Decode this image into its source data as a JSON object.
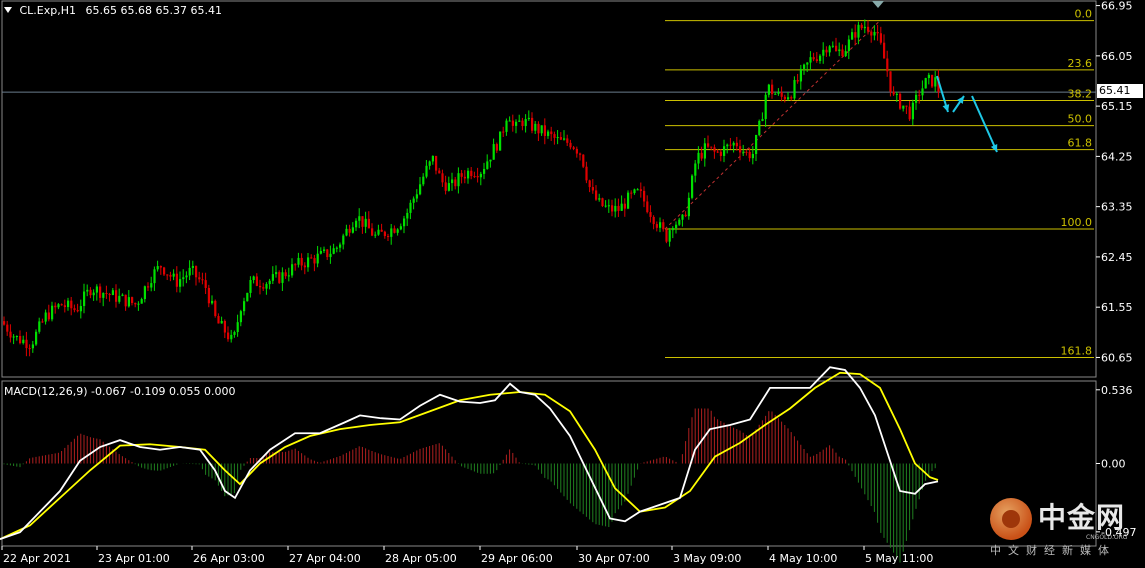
{
  "header": {
    "symbol_label": "CL.Exp,H1",
    "ohlc": "65.65 65.68 65.37 65.41"
  },
  "macd_header": {
    "label": "MACD(12,26,9)",
    "values": "-0.067 -0.109 0.055 0.000"
  },
  "current_price": "65.41",
  "watermark": {
    "brand": "中金网",
    "tagline": "中文财经新媒体",
    "domain": "CNGOLD.ORG"
  },
  "colors": {
    "bull": "#00e000",
    "bear": "#e00000",
    "fib": "#ccc000",
    "macd_line": "#ffffff",
    "signal_line": "#ffff00",
    "arrow": "#1ec8e6",
    "axis": "#ffffff"
  },
  "chart_data": [
    {
      "type": "candlestick",
      "symbol": "CL.Exp",
      "timeframe": "H1",
      "y_ticks": [
        "66.95",
        "66.05",
        "65.15",
        "64.25",
        "63.35",
        "62.45",
        "61.55",
        "60.65"
      ],
      "y_range": [
        60.3,
        67.05
      ],
      "x_ticks": [
        "22 Apr 2021",
        "23 Apr 01:00",
        "26 Apr 03:00",
        "27 Apr 04:00",
        "28 Apr 05:00",
        "29 Apr 06:00",
        "30 Apr 07:00",
        "3 May 09:00",
        "4 May 10:00",
        "5 May 11:00"
      ],
      "price_path": [
        [
          0,
          61.3
        ],
        [
          15,
          61.0
        ],
        [
          30,
          60.9
        ],
        [
          45,
          61.4
        ],
        [
          60,
          61.6
        ],
        [
          75,
          61.5
        ],
        [
          90,
          61.9
        ],
        [
          105,
          61.8
        ],
        [
          120,
          61.7
        ],
        [
          135,
          61.6
        ],
        [
          150,
          62.1
        ],
        [
          160,
          62.3
        ],
        [
          175,
          62.0
        ],
        [
          190,
          62.2
        ],
        [
          205,
          61.9
        ],
        [
          215,
          61.3
        ],
        [
          225,
          61.1
        ],
        [
          232,
          60.9
        ],
        [
          240,
          61.6
        ],
        [
          250,
          62.0
        ],
        [
          265,
          62.0
        ],
        [
          280,
          62.1
        ],
        [
          295,
          62.3
        ],
        [
          310,
          62.4
        ],
        [
          325,
          62.5
        ],
        [
          335,
          62.6
        ],
        [
          345,
          62.9
        ],
        [
          355,
          63.2
        ],
        [
          365,
          63.0
        ],
        [
          375,
          62.8
        ],
        [
          385,
          62.9
        ],
        [
          395,
          63.0
        ],
        [
          405,
          63.2
        ],
        [
          415,
          63.6
        ],
        [
          425,
          64.0
        ],
        [
          432,
          64.2
        ],
        [
          440,
          63.8
        ],
        [
          450,
          63.7
        ],
        [
          460,
          63.9
        ],
        [
          470,
          64.0
        ],
        [
          480,
          64.0
        ],
        [
          490,
          64.3
        ],
        [
          500,
          64.6
        ],
        [
          507,
          65.1
        ],
        [
          513,
          64.7
        ],
        [
          520,
          64.9
        ],
        [
          530,
          64.8
        ],
        [
          540,
          64.7
        ],
        [
          550,
          64.6
        ],
        [
          560,
          64.5
        ],
        [
          570,
          64.5
        ],
        [
          580,
          64.3
        ],
        [
          590,
          63.6
        ],
        [
          598,
          63.4
        ],
        [
          608,
          63.3
        ],
        [
          618,
          63.3
        ],
        [
          628,
          63.5
        ],
        [
          638,
          63.6
        ],
        [
          648,
          63.3
        ],
        [
          658,
          63.0
        ],
        [
          665,
          62.8
        ],
        [
          672,
          63.1
        ],
        [
          680,
          63.0
        ],
        [
          688,
          63.5
        ],
        [
          695,
          64.2
        ],
        [
          705,
          64.4
        ],
        [
          715,
          64.3
        ],
        [
          725,
          64.4
        ],
        [
          735,
          64.5
        ],
        [
          745,
          64.3
        ],
        [
          752,
          64.3
        ],
        [
          760,
          64.9
        ],
        [
          766,
          65.5
        ],
        [
          772,
          65.4
        ],
        [
          780,
          65.3
        ],
        [
          790,
          65.4
        ],
        [
          800,
          65.7
        ],
        [
          810,
          66.0
        ],
        [
          820,
          66.1
        ],
        [
          828,
          66.3
        ],
        [
          835,
          66.1
        ],
        [
          845,
          66.2
        ],
        [
          855,
          66.5
        ],
        [
          865,
          66.6
        ],
        [
          873,
          66.5
        ],
        [
          880,
          66.2
        ],
        [
          886,
          65.8
        ],
        [
          892,
          65.3
        ],
        [
          900,
          65.2
        ],
        [
          910,
          65.0
        ],
        [
          918,
          65.4
        ],
        [
          926,
          65.6
        ],
        [
          935,
          65.6
        ],
        [
          938,
          65.41
        ]
      ],
      "fibonacci": [
        {
          "label": "0.0",
          "price": 66.68
        },
        {
          "label": "23.6",
          "price": 65.8
        },
        {
          "label": "38.2",
          "price": 65.25
        },
        {
          "label": "50.0",
          "price": 64.8
        },
        {
          "label": "61.8",
          "price": 64.37
        },
        {
          "label": "100.0",
          "price": 62.95
        },
        {
          "label": "161.8",
          "price": 60.65
        }
      ]
    },
    {
      "type": "macd",
      "params": "12,26,9",
      "y_ticks": [
        "0.536",
        "0.00",
        "-0.497"
      ],
      "y_range": [
        -0.6,
        0.6
      ],
      "macd_path": [
        [
          0,
          -0.55
        ],
        [
          20,
          -0.5
        ],
        [
          40,
          -0.35
        ],
        [
          60,
          -0.2
        ],
        [
          80,
          0.02
        ],
        [
          100,
          0.12
        ],
        [
          120,
          0.17
        ],
        [
          140,
          0.12
        ],
        [
          160,
          0.1
        ],
        [
          180,
          0.12
        ],
        [
          200,
          0.1
        ],
        [
          215,
          -0.05
        ],
        [
          225,
          -0.2
        ],
        [
          235,
          -0.25
        ],
        [
          250,
          -0.05
        ],
        [
          270,
          0.1
        ],
        [
          295,
          0.22
        ],
        [
          320,
          0.22
        ],
        [
          345,
          0.3
        ],
        [
          360,
          0.35
        ],
        [
          380,
          0.33
        ],
        [
          400,
          0.32
        ],
        [
          420,
          0.42
        ],
        [
          440,
          0.5
        ],
        [
          460,
          0.45
        ],
        [
          480,
          0.44
        ],
        [
          495,
          0.46
        ],
        [
          510,
          0.58
        ],
        [
          520,
          0.52
        ],
        [
          535,
          0.5
        ],
        [
          550,
          0.4
        ],
        [
          570,
          0.2
        ],
        [
          590,
          -0.1
        ],
        [
          610,
          -0.4
        ],
        [
          625,
          -0.42
        ],
        [
          640,
          -0.35
        ],
        [
          660,
          -0.3
        ],
        [
          680,
          -0.25
        ],
        [
          695,
          0.1
        ],
        [
          710,
          0.25
        ],
        [
          730,
          0.28
        ],
        [
          750,
          0.32
        ],
        [
          770,
          0.55
        ],
        [
          790,
          0.55
        ],
        [
          810,
          0.55
        ],
        [
          830,
          0.7
        ],
        [
          845,
          0.68
        ],
        [
          860,
          0.55
        ],
        [
          875,
          0.35
        ],
        [
          890,
          0.02
        ],
        [
          900,
          -0.2
        ],
        [
          915,
          -0.22
        ],
        [
          925,
          -0.15
        ],
        [
          938,
          -0.13
        ]
      ],
      "signal_path": [
        [
          0,
          -0.55
        ],
        [
          30,
          -0.45
        ],
        [
          60,
          -0.25
        ],
        [
          90,
          -0.05
        ],
        [
          120,
          0.13
        ],
        [
          150,
          0.14
        ],
        [
          180,
          0.12
        ],
        [
          205,
          0.1
        ],
        [
          225,
          -0.05
        ],
        [
          240,
          -0.15
        ],
        [
          260,
          0.0
        ],
        [
          285,
          0.12
        ],
        [
          310,
          0.2
        ],
        [
          340,
          0.25
        ],
        [
          370,
          0.28
        ],
        [
          400,
          0.3
        ],
        [
          430,
          0.38
        ],
        [
          460,
          0.46
        ],
        [
          490,
          0.5
        ],
        [
          520,
          0.52
        ],
        [
          545,
          0.5
        ],
        [
          570,
          0.38
        ],
        [
          595,
          0.1
        ],
        [
          615,
          -0.18
        ],
        [
          640,
          -0.35
        ],
        [
          665,
          -0.32
        ],
        [
          690,
          -0.2
        ],
        [
          715,
          0.05
        ],
        [
          740,
          0.15
        ],
        [
          765,
          0.28
        ],
        [
          790,
          0.4
        ],
        [
          815,
          0.55
        ],
        [
          840,
          0.66
        ],
        [
          860,
          0.65
        ],
        [
          880,
          0.55
        ],
        [
          900,
          0.25
        ],
        [
          915,
          0.0
        ],
        [
          930,
          -0.1
        ],
        [
          938,
          -0.12
        ]
      ]
    }
  ]
}
